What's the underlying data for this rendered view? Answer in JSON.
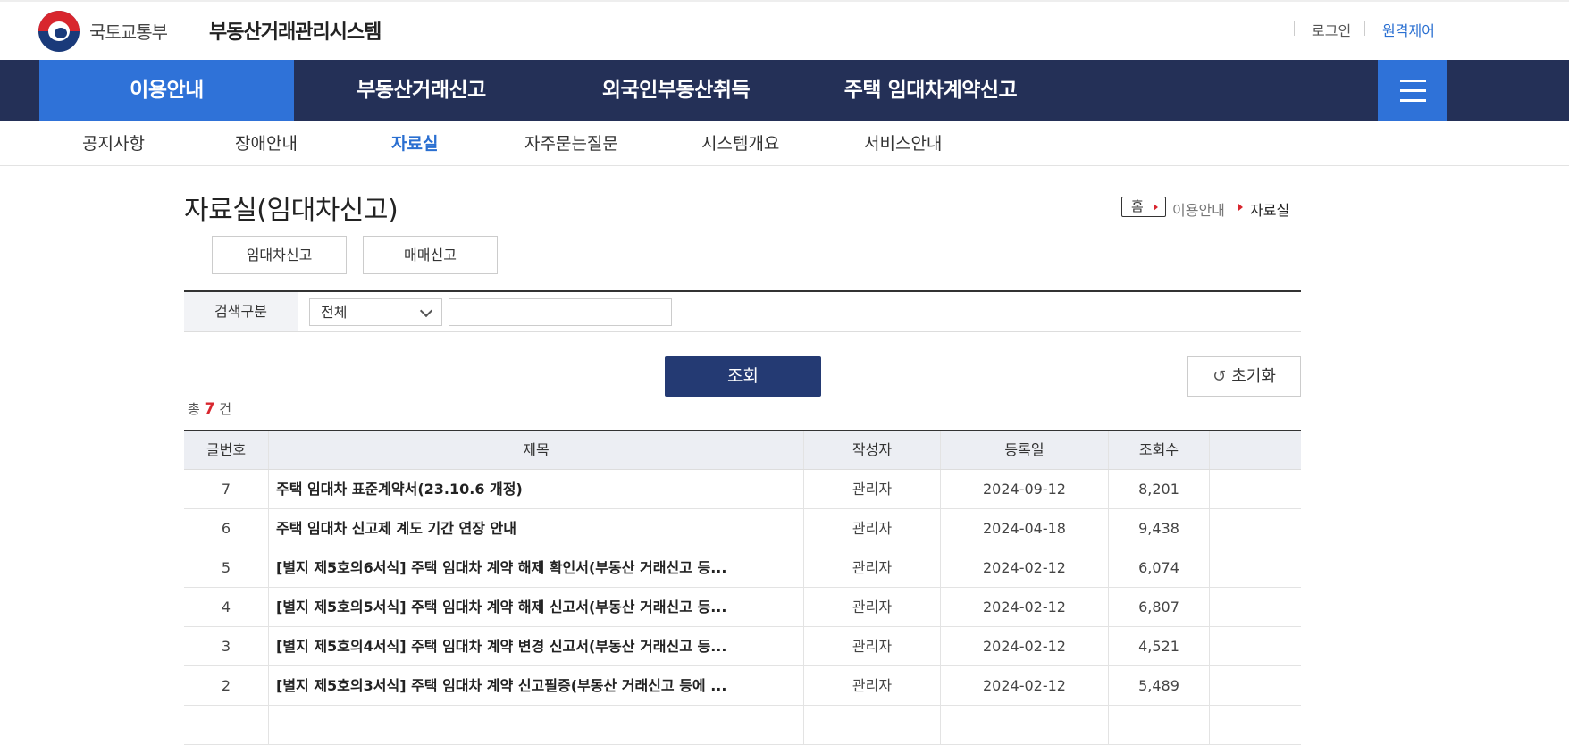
{
  "header": {
    "ministry": "국토교통부",
    "system": "부동산거래관리시스템",
    "util": {
      "login": "로그인",
      "remote": "원격제어"
    }
  },
  "mainnav": {
    "items": [
      "이용안내",
      "부동산거래신고",
      "외국인부동산취득",
      "주택 임대차계약신고"
    ],
    "menu_icon": "hamburger-icon"
  },
  "subnav": {
    "items": [
      "공지사항",
      "장애안내",
      "자료실",
      "자주묻는질문",
      "시스템개요",
      "서비스안내"
    ],
    "active": "자료실"
  },
  "page": {
    "title": "자료실(임대차신고)",
    "breadcrumb": {
      "home": "홈",
      "level1": "이용안내",
      "level2": "자료실"
    },
    "tabs": [
      "임대차신고",
      "매매신고"
    ]
  },
  "search": {
    "label": "검색구분",
    "select_value": "전체",
    "input_value": "",
    "query_button": "조회",
    "reset_button": "초기화"
  },
  "count": {
    "prefix": "총",
    "value": "7",
    "suffix": "건"
  },
  "table": {
    "headers": {
      "no": "글번호",
      "title": "제목",
      "author": "작성자",
      "date": "등록일",
      "views": "조회수"
    },
    "rows": [
      {
        "no": "7",
        "title": "주택 임대차 표준계약서(23.10.6 개정)",
        "author": "관리자",
        "date": "2024-09-12",
        "views": "8,201"
      },
      {
        "no": "6",
        "title": "주택 임대차 신고제 계도 기간 연장 안내",
        "author": "관리자",
        "date": "2024-04-18",
        "views": "9,438"
      },
      {
        "no": "5",
        "title": "[별지 제5호의6서식] 주택 임대차 계약 해제 확인서(부동산 거래신고 등...",
        "author": "관리자",
        "date": "2024-02-12",
        "views": "6,074"
      },
      {
        "no": "4",
        "title": "[별지 제5호의5서식] 주택 임대차 계약 해제 신고서(부동산 거래신고 등...",
        "author": "관리자",
        "date": "2024-02-12",
        "views": "6,807"
      },
      {
        "no": "3",
        "title": "[별지 제5호의4서식] 주택 임대차 계약 변경 신고서(부동산 거래신고 등...",
        "author": "관리자",
        "date": "2024-02-12",
        "views": "4,521"
      },
      {
        "no": "2",
        "title": "[별지 제5호의3서식] 주택 임대차 계약 신고필증(부동산 거래신고 등에 ...",
        "author": "관리자",
        "date": "2024-02-12",
        "views": "5,489"
      }
    ]
  },
  "colors": {
    "navy": "#243057",
    "accent": "#2f72d8",
    "red": "#d8262e"
  }
}
